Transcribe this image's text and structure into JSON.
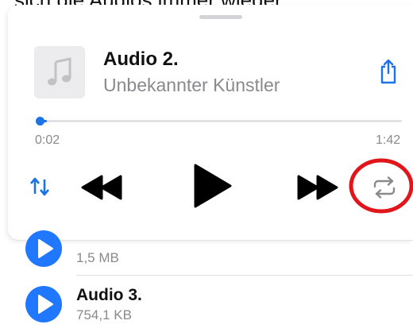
{
  "caption": "sich die Audios immer wieder.",
  "now_playing": {
    "title": "Audio 2.",
    "artist": "Unbekannter Künstler",
    "elapsed": "0:02",
    "duration": "1:42",
    "progress_fraction": 0.02
  },
  "controls": {
    "sort": "sort-arrows-icon",
    "rewind": "rewind-icon",
    "play": "play-icon",
    "forward": "fast-forward-icon",
    "repeat": "repeat-icon",
    "accent": "#1a73e8",
    "highlight": "#e0161b"
  },
  "list": [
    {
      "title": "",
      "size": "1,5 MB"
    },
    {
      "title": "Audio 3.",
      "size": "754,1 KB"
    }
  ]
}
